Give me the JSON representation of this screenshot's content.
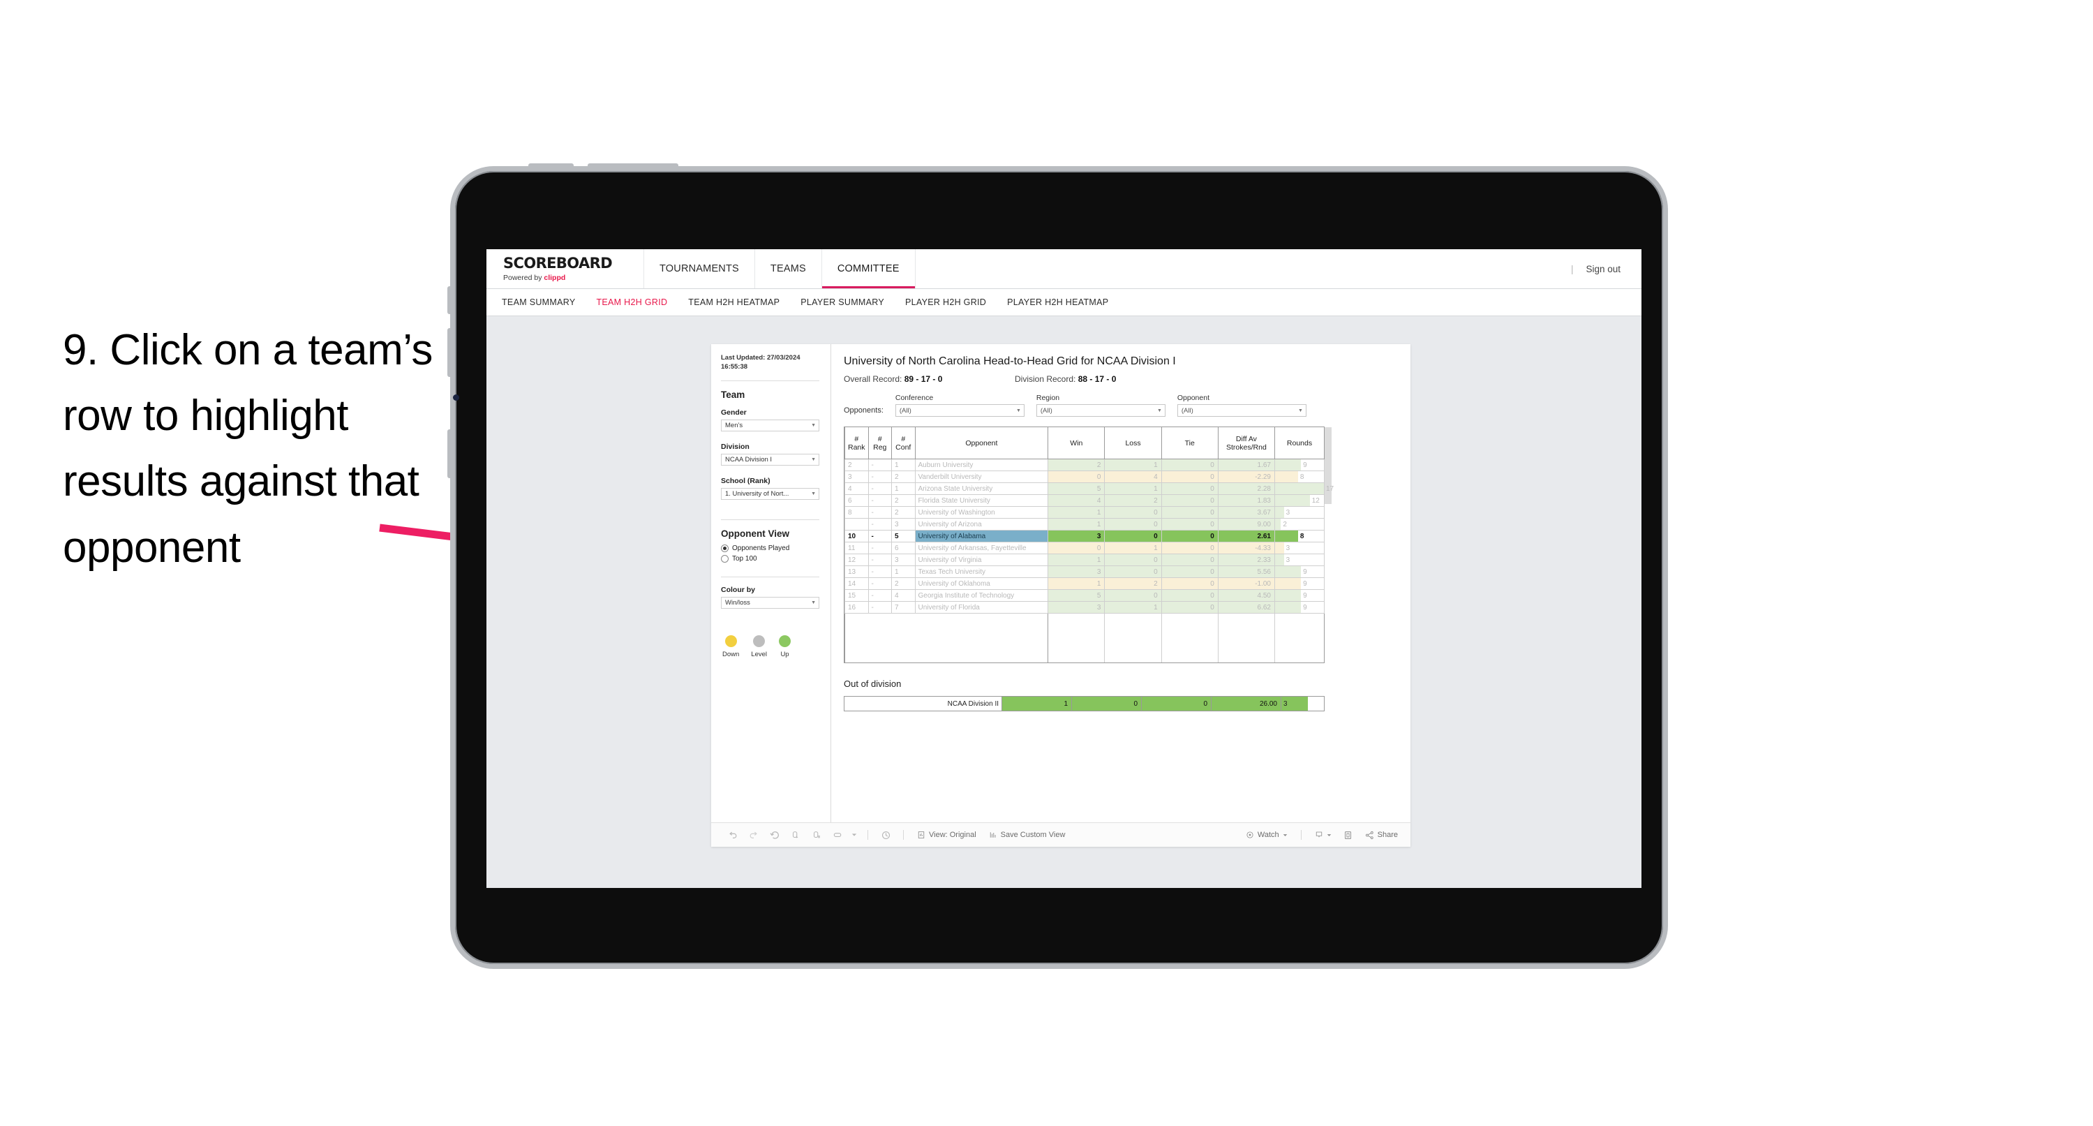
{
  "annotation": {
    "text": "9. Click on a team’s row to highlight results against that opponent",
    "arrow_color": "#ed1e63"
  },
  "app": {
    "brand": {
      "title": "SCOREBOARD",
      "powered_prefix": "Powered by ",
      "powered_brand": "clippd"
    },
    "top_nav": [
      {
        "label": "TOURNAMENTS",
        "active": false
      },
      {
        "label": "TEAMS",
        "active": false
      },
      {
        "label": "COMMITTEE",
        "active": true
      }
    ],
    "top_right": {
      "separator": "|",
      "sign_out": "Sign out"
    },
    "sub_nav": [
      {
        "label": "TEAM SUMMARY",
        "active": false
      },
      {
        "label": "TEAM H2H GRID",
        "active": true
      },
      {
        "label": "TEAM H2H HEATMAP",
        "active": false
      },
      {
        "label": "PLAYER SUMMARY",
        "active": false
      },
      {
        "label": "PLAYER H2H GRID",
        "active": false
      },
      {
        "label": "PLAYER H2H HEATMAP",
        "active": false
      }
    ]
  },
  "sidebar": {
    "last_updated": "Last Updated: 27/03/2024 16:55:38",
    "team_heading": "Team",
    "gender": {
      "label": "Gender",
      "value": "Men’s"
    },
    "division": {
      "label": "Division",
      "value": "NCAA Division I"
    },
    "school": {
      "label": "School (Rank)",
      "value": "1. University of Nort..."
    },
    "opponent_view": {
      "heading": "Opponent View",
      "options": [
        {
          "label": "Opponents Played",
          "selected": true
        },
        {
          "label": "Top 100",
          "selected": false
        }
      ]
    },
    "colour_by": {
      "label": "Colour by",
      "value": "Win/loss"
    },
    "legend": [
      {
        "label": "Down",
        "color": "#f2cf3f"
      },
      {
        "label": "Level",
        "color": "#bdbdbd"
      },
      {
        "label": "Up",
        "color": "#8cc861"
      }
    ]
  },
  "viz": {
    "title": "University of North Carolina Head-to-Head Grid for NCAA Division I",
    "overall_record_label": "Overall Record:",
    "overall_record_value": "89 - 17 - 0",
    "division_record_label": "Division Record:",
    "division_record_value": "88 - 17 - 0",
    "opponents_label": "Opponents:",
    "filters": [
      {
        "caption": "Conference",
        "value": "(All)"
      },
      {
        "caption": "Region",
        "value": "(All)"
      },
      {
        "caption": "Opponent",
        "value": "(All)"
      }
    ]
  },
  "chart_data": {
    "type": "table",
    "title": "University of North Carolina Head-to-Head Grid for NCAA Division I",
    "columns": [
      "# Rank",
      "# Reg",
      "# Conf",
      "Opponent",
      "Win",
      "Loss",
      "Tie",
      "Diff Av Strokes/Rnd",
      "Rounds"
    ],
    "column_headers_multiline": [
      [
        "#",
        "Rank"
      ],
      [
        "#",
        "Reg"
      ],
      [
        "#",
        "Conf"
      ],
      [
        "Opponent"
      ],
      [
        "Win"
      ],
      [
        "Loss"
      ],
      [
        "Tie"
      ],
      [
        "Diff Av",
        "Strokes/Rnd"
      ],
      [
        "Rounds"
      ]
    ],
    "rounds_max": 17,
    "rows": [
      {
        "rank": "2",
        "reg": "-",
        "conf": "1",
        "opponent": "Auburn University",
        "win": "2",
        "loss": "1",
        "tie": "0",
        "diff": "1.67",
        "rounds": "9",
        "tone": "up",
        "selected": false
      },
      {
        "rank": "3",
        "reg": "-",
        "conf": "2",
        "opponent": "Vanderbilt University",
        "win": "0",
        "loss": "4",
        "tie": "0",
        "diff": "-2.29",
        "rounds": "8",
        "tone": "down",
        "selected": false
      },
      {
        "rank": "4",
        "reg": "-",
        "conf": "1",
        "opponent": "Arizona State University",
        "win": "5",
        "loss": "1",
        "tie": "0",
        "diff": "2.28",
        "rounds": "17",
        "tone": "up",
        "selected": false
      },
      {
        "rank": "6",
        "reg": "-",
        "conf": "2",
        "opponent": "Florida State University",
        "win": "4",
        "loss": "2",
        "tie": "0",
        "diff": "1.83",
        "rounds": "12",
        "tone": "up",
        "selected": false
      },
      {
        "rank": "8",
        "reg": "-",
        "conf": "2",
        "opponent": "University of Washington",
        "win": "1",
        "loss": "0",
        "tie": "0",
        "diff": "3.67",
        "rounds": "3",
        "tone": "up",
        "selected": false
      },
      {
        "rank": "",
        "reg": "-",
        "conf": "3",
        "opponent": "University of Arizona",
        "win": "1",
        "loss": "0",
        "tie": "0",
        "diff": "9.00",
        "rounds": "2",
        "tone": "up",
        "selected": false
      },
      {
        "rank": "10",
        "reg": "-",
        "conf": "5",
        "opponent": "University of Alabama",
        "win": "3",
        "loss": "0",
        "tie": "0",
        "diff": "2.61",
        "rounds": "8",
        "tone": "up",
        "selected": true
      },
      {
        "rank": "11",
        "reg": "-",
        "conf": "6",
        "opponent": "University of Arkansas, Fayetteville",
        "win": "0",
        "loss": "1",
        "tie": "0",
        "diff": "-4.33",
        "rounds": "3",
        "tone": "down",
        "selected": false
      },
      {
        "rank": "12",
        "reg": "-",
        "conf": "3",
        "opponent": "University of Virginia",
        "win": "1",
        "loss": "0",
        "tie": "0",
        "diff": "2.33",
        "rounds": "3",
        "tone": "up",
        "selected": false
      },
      {
        "rank": "13",
        "reg": "-",
        "conf": "1",
        "opponent": "Texas Tech University",
        "win": "3",
        "loss": "0",
        "tie": "0",
        "diff": "5.56",
        "rounds": "9",
        "tone": "up",
        "selected": false
      },
      {
        "rank": "14",
        "reg": "-",
        "conf": "2",
        "opponent": "University of Oklahoma",
        "win": "1",
        "loss": "2",
        "tie": "0",
        "diff": "-1.00",
        "rounds": "9",
        "tone": "down",
        "selected": false
      },
      {
        "rank": "15",
        "reg": "-",
        "conf": "4",
        "opponent": "Georgia Institute of Technology",
        "win": "5",
        "loss": "0",
        "tie": "0",
        "diff": "4.50",
        "rounds": "9",
        "tone": "up",
        "selected": false
      },
      {
        "rank": "16",
        "reg": "-",
        "conf": "7",
        "opponent": "University of Florida",
        "win": "3",
        "loss": "1",
        "tie": "0",
        "diff": "6.62",
        "rounds": "9",
        "tone": "up",
        "selected": false
      }
    ],
    "out_of_division": {
      "title": "Out of division",
      "label": "NCAA Division II",
      "win": "1",
      "loss": "0",
      "tie": "0",
      "diff": "26.00",
      "rounds": "3"
    },
    "colors": {
      "up_fill": "#e4efdc",
      "down_fill": "#faf0d7",
      "selected_fill": "#86c45c",
      "selected_opponent_fill": "#7aafc9",
      "rounds_bar_up": "#e4efdc",
      "rounds_bar_down": "#faf0d7",
      "rounds_bar_selected": "#86c45c"
    }
  },
  "toolbar": {
    "icons": [
      "undo-icon",
      "redo-icon",
      "revert-icon",
      "refresh-icon",
      "pause-icon",
      "device-layout-icon",
      "caret-down-icon",
      "clock-icon"
    ],
    "view_original": "View: Original",
    "save_custom_view": "Save Custom View",
    "watch": "Watch",
    "download_caret": "▾",
    "share": "Share"
  }
}
